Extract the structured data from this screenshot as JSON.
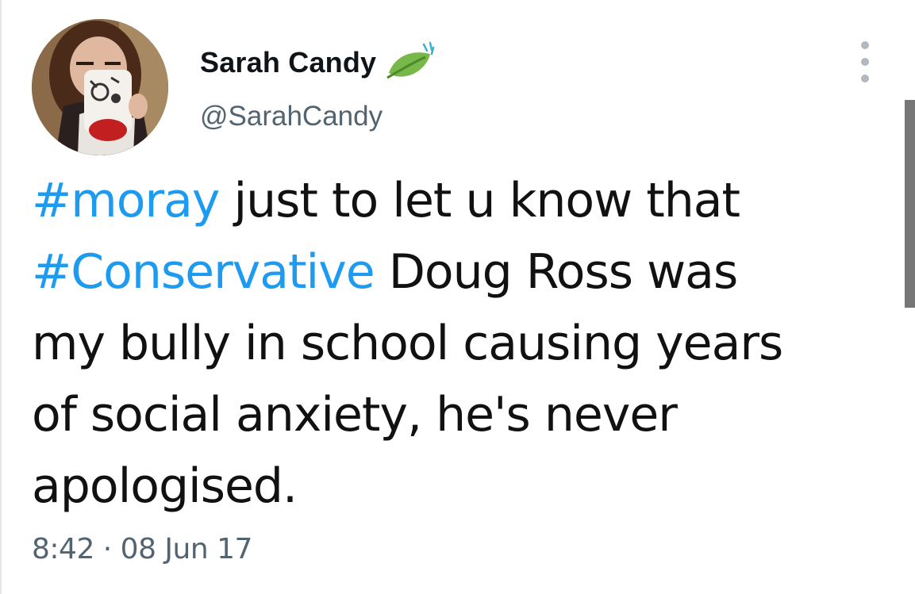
{
  "author": {
    "display_name": "Sarah Candy",
    "handle": "@SarahCandy",
    "avatar_icon": "profile-photo",
    "badge_icon": "leaf-icon"
  },
  "tweet": {
    "lines": [
      {
        "hashtag": "#moray",
        "text": " just to let u know that"
      },
      {
        "hashtag": "#Conservative",
        "text": " Doug Ross was"
      },
      {
        "hashtag": "",
        "text": "my bully in school causing years"
      },
      {
        "hashtag": "",
        "text": "of social anxiety, he's never"
      },
      {
        "hashtag": "",
        "text": "apologised."
      }
    ],
    "timestamp": "8:42 · 08 Jun 17"
  },
  "colors": {
    "hashtag": "#1d9bf0",
    "text": "#111111",
    "secondary": "#536471"
  },
  "menu_icon": "more-vertical-icon"
}
